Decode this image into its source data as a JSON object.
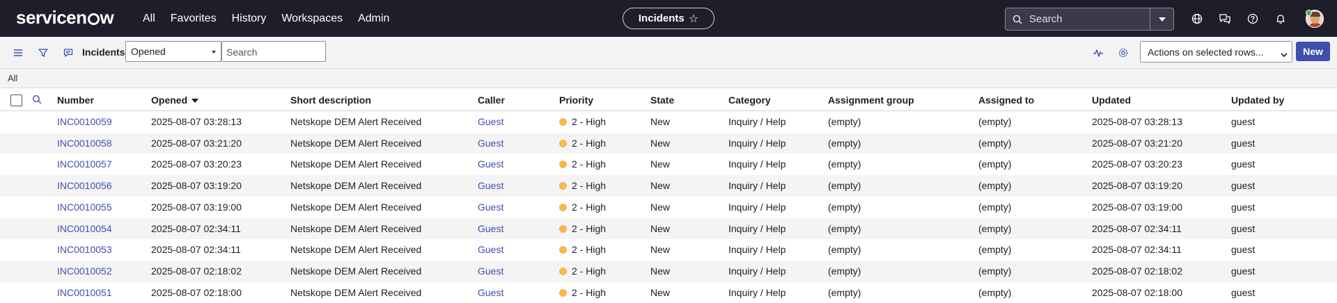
{
  "header": {
    "brand": "servicenow",
    "nav": [
      "All",
      "Favorites",
      "History",
      "Workspaces",
      "Admin"
    ],
    "context_pill": "Incidents",
    "search_placeholder": "Search"
  },
  "toolbar": {
    "list_title": "Incidents",
    "filter_field": "Opened",
    "search_placeholder": "Search",
    "actions_label": "Actions on selected rows...",
    "new_label": "New"
  },
  "breadcrumb": "All",
  "columns": [
    "Number",
    "Opened",
    "Short description",
    "Caller",
    "Priority",
    "State",
    "Category",
    "Assignment group",
    "Assigned to",
    "Updated",
    "Updated by"
  ],
  "rows": [
    {
      "number": "INC0010059",
      "opened": "2025-08-07 03:28:13",
      "short_description": "Netskope DEM Alert Received",
      "caller": "Guest",
      "priority": "2 - High",
      "state": "New",
      "category": "Inquiry / Help",
      "assignment_group": "(empty)",
      "assigned_to": "(empty)",
      "updated": "2025-08-07 03:28:13",
      "updated_by": "guest"
    },
    {
      "number": "INC0010058",
      "opened": "2025-08-07 03:21:20",
      "short_description": "Netskope DEM Alert Received",
      "caller": "Guest",
      "priority": "2 - High",
      "state": "New",
      "category": "Inquiry / Help",
      "assignment_group": "(empty)",
      "assigned_to": "(empty)",
      "updated": "2025-08-07 03:21:20",
      "updated_by": "guest"
    },
    {
      "number": "INC0010057",
      "opened": "2025-08-07 03:20:23",
      "short_description": "Netskope DEM Alert Received",
      "caller": "Guest",
      "priority": "2 - High",
      "state": "New",
      "category": "Inquiry / Help",
      "assignment_group": "(empty)",
      "assigned_to": "(empty)",
      "updated": "2025-08-07 03:20:23",
      "updated_by": "guest"
    },
    {
      "number": "INC0010056",
      "opened": "2025-08-07 03:19:20",
      "short_description": "Netskope DEM Alert Received",
      "caller": "Guest",
      "priority": "2 - High",
      "state": "New",
      "category": "Inquiry / Help",
      "assignment_group": "(empty)",
      "assigned_to": "(empty)",
      "updated": "2025-08-07 03:19:20",
      "updated_by": "guest"
    },
    {
      "number": "INC0010055",
      "opened": "2025-08-07 03:19:00",
      "short_description": "Netskope DEM Alert Received",
      "caller": "Guest",
      "priority": "2 - High",
      "state": "New",
      "category": "Inquiry / Help",
      "assignment_group": "(empty)",
      "assigned_to": "(empty)",
      "updated": "2025-08-07 03:19:00",
      "updated_by": "guest"
    },
    {
      "number": "INC0010054",
      "opened": "2025-08-07 02:34:11",
      "short_description": "Netskope DEM Alert Received",
      "caller": "Guest",
      "priority": "2 - High",
      "state": "New",
      "category": "Inquiry / Help",
      "assignment_group": "(empty)",
      "assigned_to": "(empty)",
      "updated": "2025-08-07 02:34:11",
      "updated_by": "guest"
    },
    {
      "number": "INC0010053",
      "opened": "2025-08-07 02:34:11",
      "short_description": "Netskope DEM Alert Received",
      "caller": "Guest",
      "priority": "2 - High",
      "state": "New",
      "category": "Inquiry / Help",
      "assignment_group": "(empty)",
      "assigned_to": "(empty)",
      "updated": "2025-08-07 02:34:11",
      "updated_by": "guest"
    },
    {
      "number": "INC0010052",
      "opened": "2025-08-07 02:18:02",
      "short_description": "Netskope DEM Alert Received",
      "caller": "Guest",
      "priority": "2 - High",
      "state": "New",
      "category": "Inquiry / Help",
      "assignment_group": "(empty)",
      "assigned_to": "(empty)",
      "updated": "2025-08-07 02:18:02",
      "updated_by": "guest"
    },
    {
      "number": "INC0010051",
      "opened": "2025-08-07 02:18:00",
      "short_description": "Netskope DEM Alert Received",
      "caller": "Guest",
      "priority": "2 - High",
      "state": "New",
      "category": "Inquiry / Help",
      "assignment_group": "(empty)",
      "assigned_to": "(empty)",
      "updated": "2025-08-07 02:18:00",
      "updated_by": "guest"
    }
  ],
  "colors": {
    "header_bg": "#1e1e2b",
    "link": "#3f4fad",
    "priority_high": "#f5b84a",
    "primary_button": "#3f4fad"
  },
  "icons": [
    "search-icon",
    "chevron-down-icon",
    "globe-icon",
    "chat-icon",
    "help-icon",
    "bell-icon",
    "menu-icon",
    "filter-icon",
    "comment-icon",
    "pulse-icon",
    "gear-icon",
    "star-icon"
  ]
}
